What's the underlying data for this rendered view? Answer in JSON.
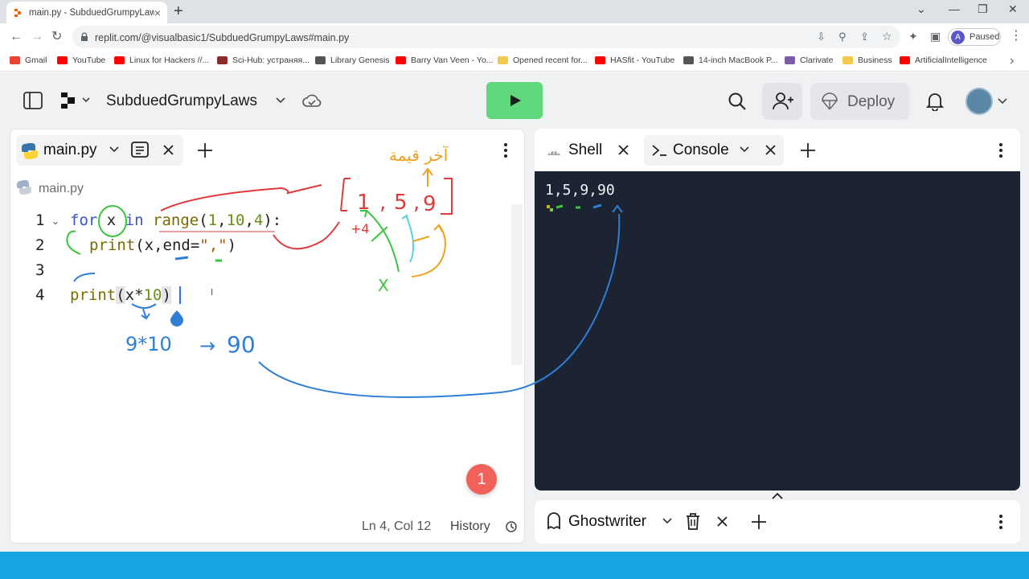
{
  "browser": {
    "tab_title": "main.py - SubduedGrumpyLaws",
    "tab_close": "×",
    "new_tab": "+",
    "url": "replit.com/@visualbasic1/SubduedGrumpyLaws#main.py",
    "profile_initial": "A",
    "profile_status": "Paused",
    "bookmarks": [
      {
        "label": "Gmail",
        "color": "#ea4335"
      },
      {
        "label": "YouTube",
        "color": "#ff0000"
      },
      {
        "label": "Linux for Hackers //...",
        "color": "#ff0000"
      },
      {
        "label": "Sci-Hub: устраняя...",
        "color": "#8b2b2b"
      },
      {
        "label": "Library Genesis",
        "color": "#555555"
      },
      {
        "label": "Barry Van Veen - Yo...",
        "color": "#ff0000"
      },
      {
        "label": "Opened recent for...",
        "color": "#f2c94c"
      },
      {
        "label": "HASfit - YouTube",
        "color": "#ff0000"
      },
      {
        "label": "14-inch MacBook P...",
        "color": "#555555"
      },
      {
        "label": "Clarivate",
        "color": "#7b5ea7"
      },
      {
        "label": "Business",
        "color": "#f2c94c"
      },
      {
        "label": "ArtificialIntelligence",
        "color": "#ff0000"
      }
    ]
  },
  "replit": {
    "project_name": "SubduedGrumpyLaws",
    "deploy_label": "Deploy",
    "editor": {
      "tab_label": "main.py",
      "breadcrumb": "main.py",
      "line_numbers": [
        "1",
        "2",
        "3",
        "4"
      ],
      "code": {
        "l1_kw1": "for",
        "l1_var": " x ",
        "l1_kw2": "in",
        "l1_fn": "range",
        "l1_open": "(",
        "l1_a": "1",
        "l1_c1": ",",
        "l1_b": "10",
        "l1_c2": ",",
        "l1_c": "4",
        "l1_close": "):",
        "l2_fn": "print",
        "l2_args": "(x,end=",
        "l2_str": "\",\"",
        "l2_close": ")",
        "l4_fn": "print",
        "l4_open": "(",
        "l4_expr": "x*",
        "l4_num": "10",
        "l4_close": ")"
      },
      "cursor_position": "Ln 4, Col 12",
      "history_label": "History",
      "notification_count": "1"
    },
    "console": {
      "shell_tab": "Shell",
      "console_tab": "Console",
      "output": "1,5,9,90"
    },
    "ghostwriter_tab": "Ghostwriter"
  },
  "annotations": {
    "list": [
      "[",
      "1",
      ",",
      "5",
      ",",
      "9",
      "]"
    ],
    "step": "+4",
    "var": "X",
    "calc": "9*10",
    "arrow": "→",
    "result": "90",
    "arabic_note": "آخر قيمة"
  },
  "colors": {
    "run_button": "#5ed87a",
    "terminal_bg": "#1c2333",
    "taskbar": "#16a4e4",
    "ink_red": "#e03a3a",
    "ink_green": "#3cc43c",
    "ink_blue": "#2f7fd6",
    "ink_orange": "#f0a020",
    "ink_cyan": "#5ad0e0"
  }
}
